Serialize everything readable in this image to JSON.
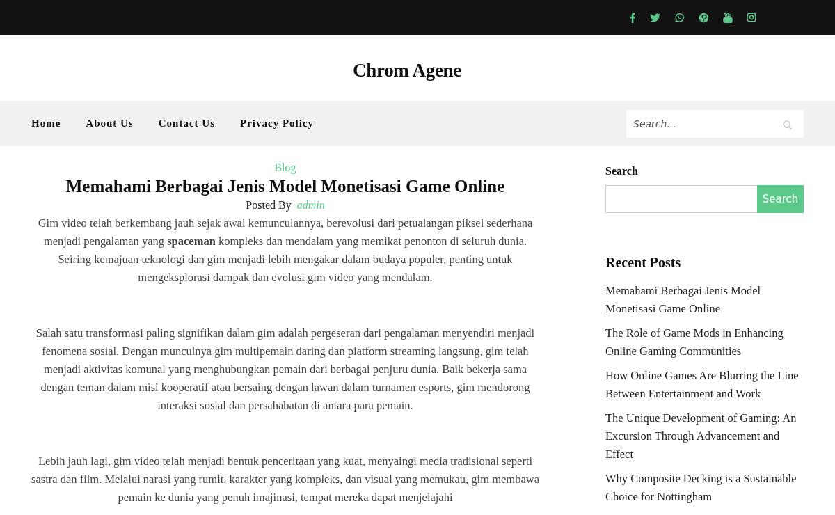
{
  "site_title": "Chrom Agene",
  "nav": {
    "items": [
      {
        "label": "Home"
      },
      {
        "label": "About Us"
      },
      {
        "label": "Contact Us"
      },
      {
        "label": "Privacy Policy"
      }
    ],
    "search": {
      "placeholder": "Search..."
    }
  },
  "post": {
    "category": "Blog",
    "title": "Memahami Berbagai Jenis Model Monetisasi Game Online",
    "posted_by_label": "Posted By",
    "author": "admin",
    "paragraphs": [
      "Gim video telah berkembang jauh sejak awal kemunculannya, berevolusi dari petualangan piksel sederhana menjadi pengalaman yang **spaceman** kompleks dan mendalam yang memikat penonton di seluruh dunia. Seiring kemajuan teknologi dan gim menjadi lebih mengakar dalam budaya populer, penting untuk mengeksplorasi dampak dan evolusi gim video yang mendalam.",
      "Salah satu transformasi paling signifikan dalam gim adalah pergeseran dari pengalaman menyendiri menjadi fenomena sosial. Dengan munculnya gim multipemain daring dan platform streaming langsung, gim telah menjadi aktivitas komunal yang menghubungkan pemain dari berbagai penjuru dunia. Baik bekerja sama dengan teman dalam misi kooperatif atau bersaing dengan lawan dalam turnamen esports, gim mendorong interaksi sosial dan persahabatan di antara para pemain.",
      "Lebih jauh lagi, gim video telah menjadi bentuk penceritaan yang kuat, menyaingi media tradisional seperti sastra dan film. Melalui narasi yang rumit, karakter yang kompleks, dan visual yang memukau, gim membawa pemain ke dunia yang penuh imajinasi, tempat mereka dapat menjelajahi"
    ]
  },
  "sidebar": {
    "search_widget": {
      "title": "Search",
      "button": "Search"
    },
    "recent_posts": {
      "title": "Recent Posts",
      "items": [
        "Memahami Berbagai Jenis Model Monetisasi Game Online",
        "The Role of Game Mods in Enhancing Online Gaming Communities",
        "How Online Games Are Blurring the Line Between Entertainment and Work",
        "The Unique Development of Gaming: An Excursion Through Advancement and Effect",
        "Why Composite Decking is a Sustainable Choice for Nottingham"
      ]
    }
  }
}
